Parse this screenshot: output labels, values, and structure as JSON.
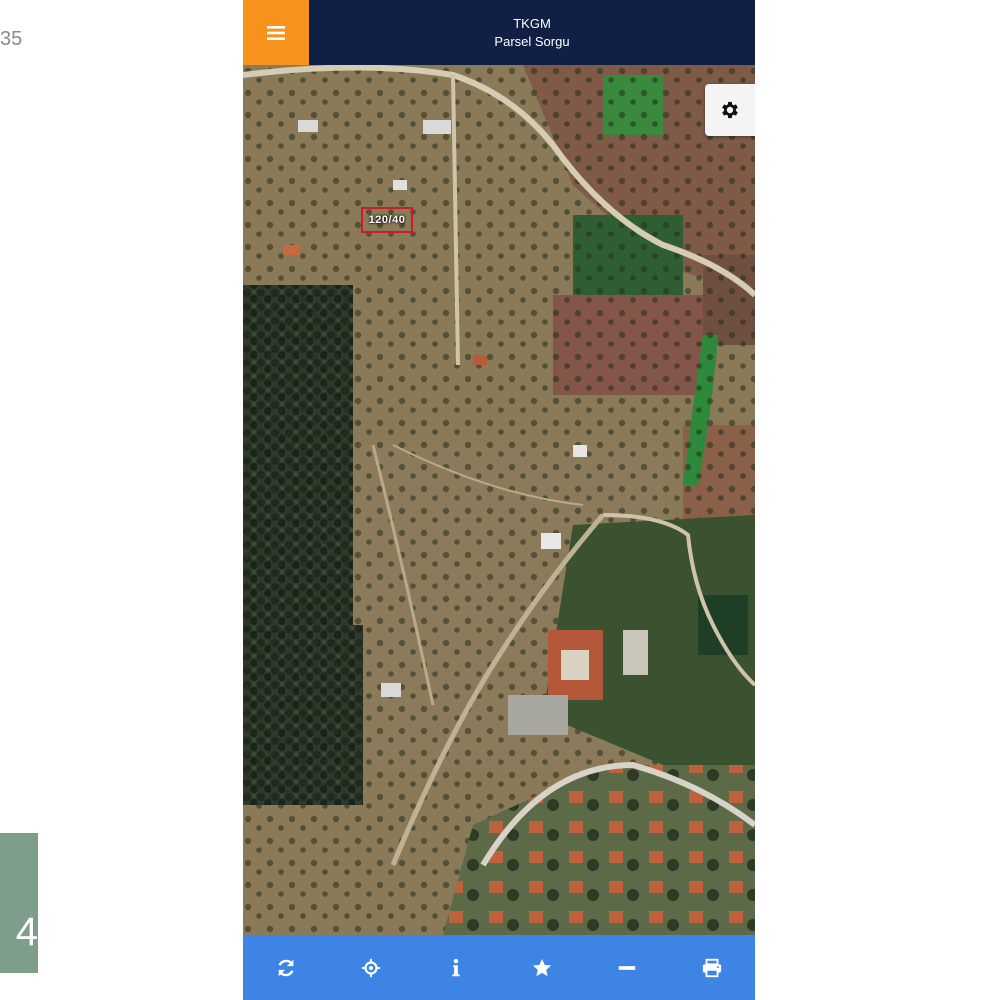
{
  "side": {
    "top_text": "35",
    "badge_text": "4"
  },
  "header": {
    "title": "TKGM",
    "subtitle": "Parsel Sorgu"
  },
  "map": {
    "parcel_label": "120/40"
  },
  "colors": {
    "header_bg": "#0f2044",
    "menu_bg": "#f7931d",
    "toolbar_bg": "#3d84e4",
    "parcel_border": "#d2192c"
  },
  "icons": {
    "menu": "hamburger-icon",
    "settings": "gear-icon",
    "toolbar": [
      "refresh-icon",
      "locate-icon",
      "info-icon",
      "star-icon",
      "measure-icon",
      "print-icon"
    ]
  }
}
